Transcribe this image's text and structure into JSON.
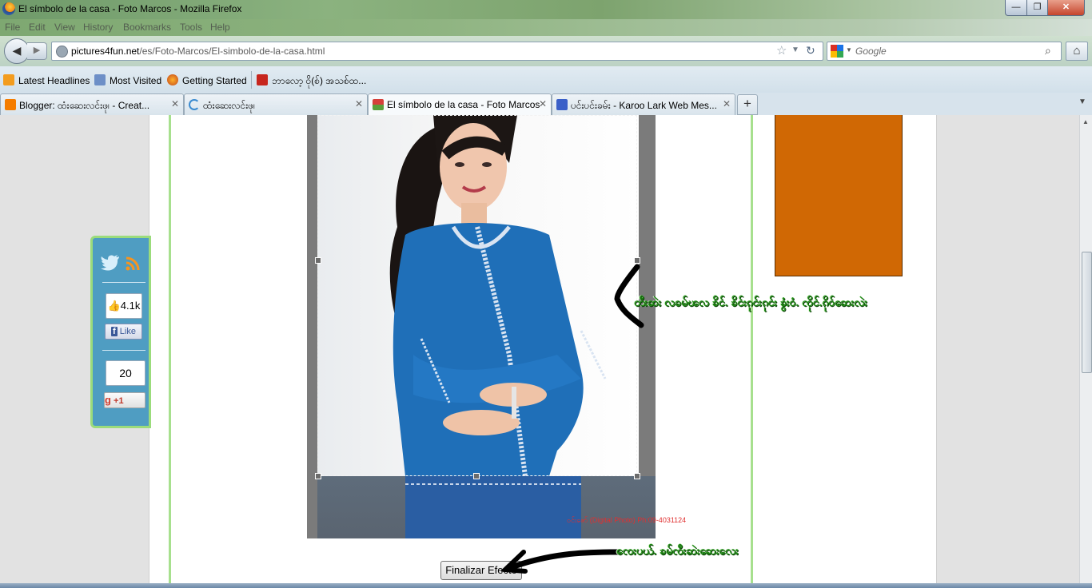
{
  "window": {
    "title": "El símbolo de la casa - Foto Marcos - Mozilla Firefox",
    "minimize": "—",
    "maximize": "❐",
    "close": "✕"
  },
  "menu": [
    "File",
    "Edit",
    "View",
    "History",
    "Bookmarks",
    "Tools",
    "Help"
  ],
  "nav": {
    "url_host": "pictures4fun.net",
    "url_path": "/es/Foto-Marcos/El-simbolo-de-la-casa.html",
    "search_placeholder": "Google"
  },
  "bookmarks": [
    "Latest Headlines",
    "Most Visited",
    "Getting Started",
    "ဘာလော့ ဝို(စ်) အသစ်ထ..."
  ],
  "tabs": [
    {
      "label": "Blogger: ထံးဆေးလင်းဖု၊ - Creat..."
    },
    {
      "label": "ထံးဆေးလင်းဖု၊"
    },
    {
      "label": "El símbolo de la casa - Foto Marcos"
    },
    {
      "label": "ပင်းပင်းခမ်း - Karoo Lark Web Mes..."
    }
  ],
  "page": {
    "photo_watermark": "ဝင်းဇော် (Digital Photo) Ph:09-4031124",
    "finalize_button": "Finalizar Efecto",
    "note_1": "တီးဆဲး လခမ်ၽလ ၶိင်. ၶိင်းၵုင်းၵုင်း ၶွံးဝံ. ၸိုင်.ၵိုဝ်ဆေးလဲး",
    "note_2": "ၸေးပယ်. ၶမ်ၸီးဆဲးဆေးလေး"
  },
  "share": {
    "fb_count": "4.1k",
    "fb_like": "Like",
    "g_count": "20",
    "g_plus": "+1"
  },
  "colors": {
    "orange_box": "#d06804",
    "frame_green": "#a7e08e",
    "share_bg": "#4f9dc2",
    "note_green": "#1f8a14"
  }
}
